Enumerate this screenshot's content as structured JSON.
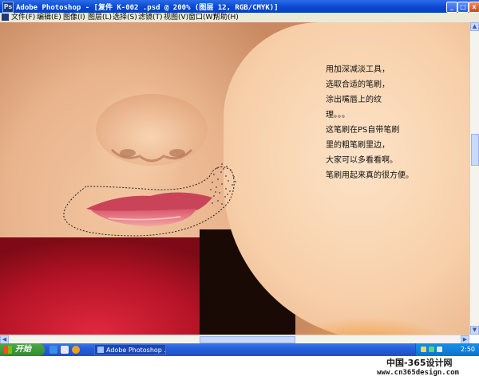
{
  "window": {
    "title": "Adobe Photoshop - [复件 K-002 .psd @ 200% (图层 12, RGB/CMYK)]",
    "minimize": "_",
    "maximize": "□",
    "close": "x"
  },
  "menu": {
    "items": [
      "文件(F)",
      "编辑(E)",
      "图像(I)",
      "图层(L)",
      "选择(S)",
      "滤镜(T)",
      "视图(V)",
      "窗口(W)",
      "帮助(H)"
    ]
  },
  "canvas": {
    "caption_lines": [
      "用加深减淡工具，",
      "选取合适的笔刷，",
      "涂出嘴唇上的纹",
      "理。。。",
      "这笔刷在PS自带笔刷",
      "里的粗笔刷里边，",
      "大家可以多看看啊。",
      "笔刷用起来真的很方便。"
    ]
  },
  "taskbar": {
    "start_label": "开始",
    "task_label": "Adobe Photoshop ...",
    "clock": "2:50"
  },
  "watermark": {
    "logo": "中国-365设计网",
    "url": "www.cn365design.com"
  },
  "colors": {
    "title_bar": "#0a49d6",
    "taskbar": "#245edb",
    "start": "#2f8b2c",
    "skin": "#f2c6a0",
    "lips": "#e56f78",
    "scarf": "#c4162b"
  }
}
